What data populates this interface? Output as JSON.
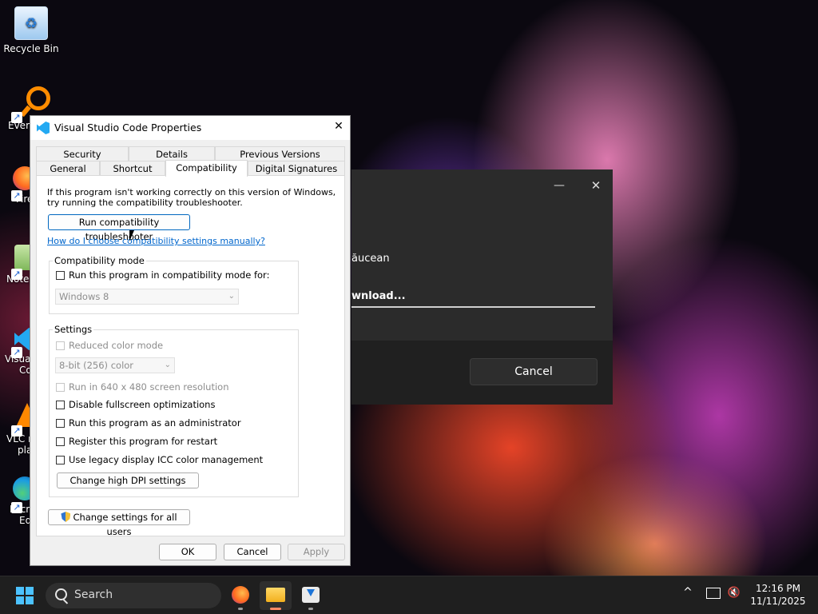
{
  "desktop": {
    "icons": [
      {
        "label": "Recycle Bin"
      },
      {
        "label": "Every"
      },
      {
        "label": "Fire"
      },
      {
        "label": "Notep"
      },
      {
        "label": "Visual"
      },
      {
        "label": "Co"
      },
      {
        "label": "VLC m"
      },
      {
        "label": "pla"
      },
      {
        "label": "Micr"
      },
      {
        "label": "Ed"
      }
    ],
    "shortcut_arrow": "↗"
  },
  "background_dialog": {
    "minimize": "—",
    "close": "✕",
    "text_line": "ăucean",
    "status_line": "wnload...",
    "cancel_label": "Cancel"
  },
  "dialog": {
    "title": "Visual Studio Code Properties",
    "close": "✕",
    "tabs_back": [
      "Security",
      "Details",
      "Previous Versions"
    ],
    "tabs_front": [
      "General",
      "Shortcut",
      "Compatibility",
      "Digital Signatures"
    ],
    "intro_line1": "If this program isn't working correctly on this version of Windows,",
    "intro_line2": "try running the compatibility troubleshooter.",
    "troubleshooter_label": "Run compatibility troubleshooter",
    "manual_link": "How do I choose compatibility settings manually?",
    "compat_mode": {
      "legend": "Compatibility mode",
      "checkbox_label": "Run this program in compatibility mode for:",
      "os_selected": "Windows 8"
    },
    "settings": {
      "legend": "Settings",
      "reduced_color": "Reduced color mode",
      "color_selected": "8-bit (256) color",
      "res_640": "Run in 640 x 480 screen resolution",
      "fullscreen_opt": "Disable fullscreen optimizations",
      "admin": "Run this program as an administrator",
      "restart": "Register this program for restart",
      "icc": "Use legacy display ICC color management",
      "dpi_label": "Change high DPI settings"
    },
    "all_users_label": "Change settings for all users",
    "ok_label": "OK",
    "cancel_label": "Cancel",
    "apply_label": "Apply"
  },
  "taskbar": {
    "search_placeholder": "Search",
    "clock_time": "12:16 PM",
    "clock_date": "11/11/2025",
    "chevron": "^"
  },
  "colors": {
    "accent": "#0067c0",
    "link": "#0066cc",
    "vscode_blue": "#23a9f2"
  }
}
